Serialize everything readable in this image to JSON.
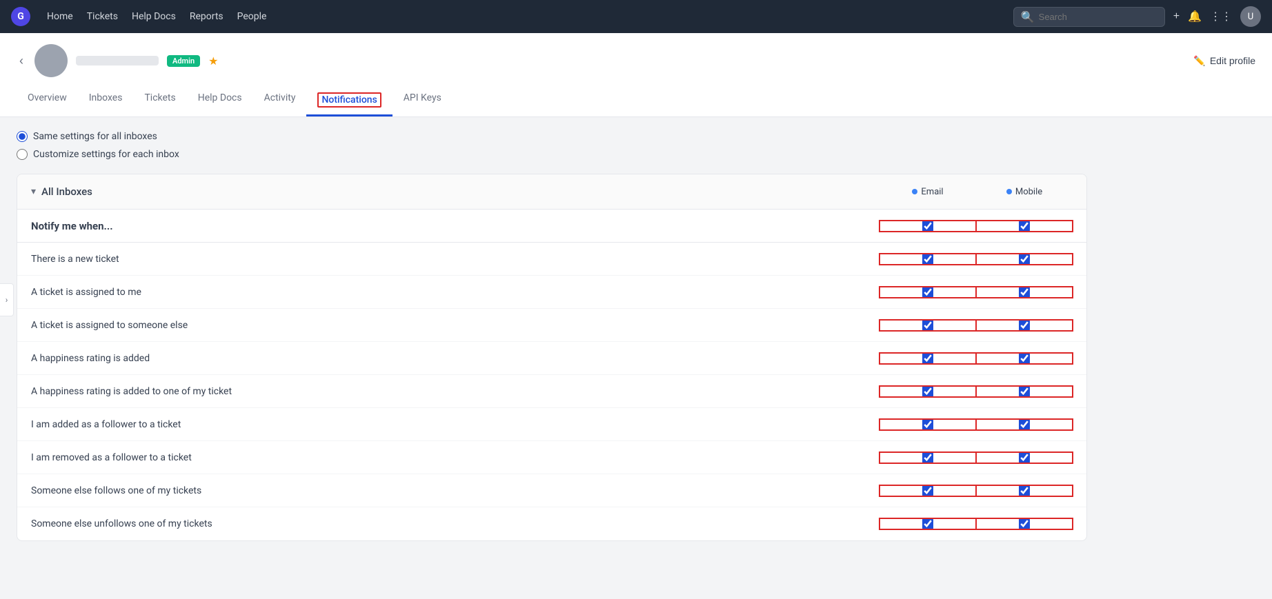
{
  "topNav": {
    "logo_text": "G",
    "links": [
      "Home",
      "Tickets",
      "Help Docs",
      "Reports",
      "People"
    ],
    "search_placeholder": "Search",
    "plus_icon": "+",
    "bell_icon": "🔔",
    "grid_icon": "⋮⋮⋮",
    "avatar_text": "U"
  },
  "profile": {
    "back_label": "‹",
    "name_placeholder": "",
    "badge_admin": "Admin",
    "star": "★",
    "edit_profile_label": "Edit profile",
    "pencil_icon": "✏️"
  },
  "tabs": [
    {
      "id": "overview",
      "label": "Overview",
      "active": false
    },
    {
      "id": "inboxes",
      "label": "Inboxes",
      "active": false
    },
    {
      "id": "tickets",
      "label": "Tickets",
      "active": false
    },
    {
      "id": "help-docs",
      "label": "Help Docs",
      "active": false
    },
    {
      "id": "activity",
      "label": "Activity",
      "active": false
    },
    {
      "id": "notifications",
      "label": "Notifications",
      "active": true
    },
    {
      "id": "api-keys",
      "label": "API Keys",
      "active": false
    }
  ],
  "settings": {
    "radio_options": [
      {
        "id": "same",
        "label": "Same settings for all inboxes",
        "checked": true
      },
      {
        "id": "custom",
        "label": "Customize settings for each inbox",
        "checked": false
      }
    ]
  },
  "inbox_section": {
    "title": "All Inboxes",
    "chevron": "▾",
    "col_email_label": "Email",
    "col_mobile_label": "Mobile",
    "notify_header": "Notify me when...",
    "rows": [
      {
        "label": "There is a new ticket",
        "email": true,
        "mobile": true
      },
      {
        "label": "A ticket is assigned to me",
        "email": true,
        "mobile": true
      },
      {
        "label": "A ticket is assigned to someone else",
        "email": true,
        "mobile": true
      },
      {
        "label": "A happiness rating is added",
        "email": true,
        "mobile": true
      },
      {
        "label": "A happiness rating is added to one of my ticket",
        "email": true,
        "mobile": true
      },
      {
        "label": "I am added as a follower to a ticket",
        "email": true,
        "mobile": true
      },
      {
        "label": "I am removed as a follower to a ticket",
        "email": true,
        "mobile": true
      },
      {
        "label": "Someone else follows one of my tickets",
        "email": true,
        "mobile": true
      },
      {
        "label": "Someone else unfollows one of my tickets",
        "email": true,
        "mobile": true
      }
    ]
  }
}
